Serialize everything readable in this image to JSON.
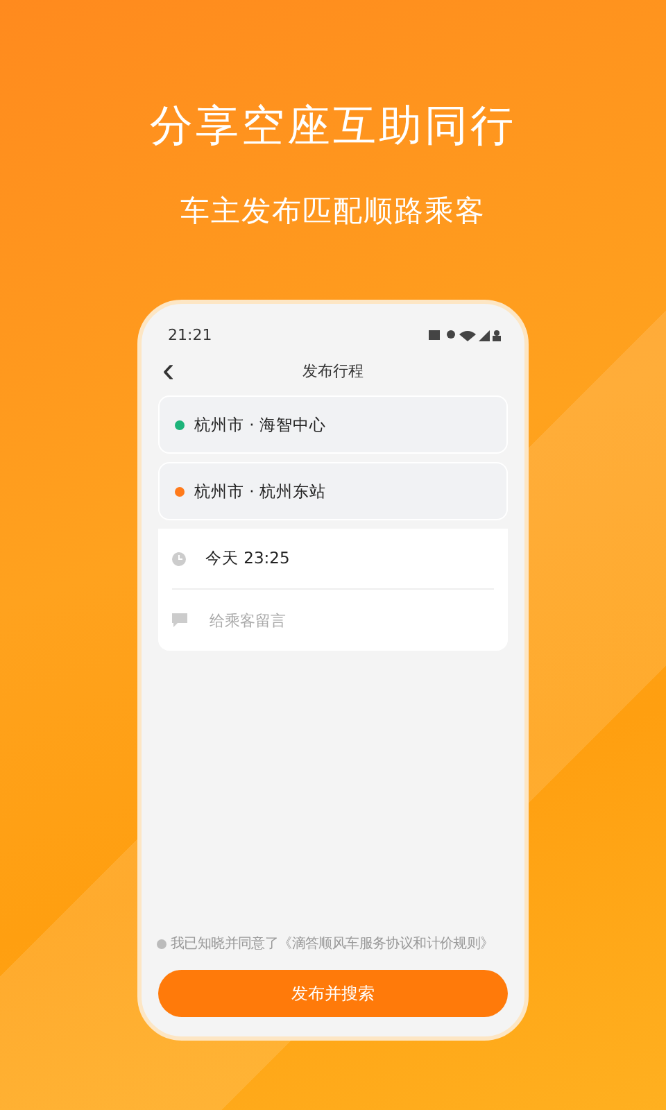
{
  "headline": "分享空座互助同行",
  "subheadline": "车主发布匹配顺路乘客",
  "phone": {
    "status_bar": {
      "time": "21:21"
    },
    "nav": {
      "back": "‹",
      "title": "发布行程"
    },
    "locations": [
      {
        "text": "杭州市 · 海智中心",
        "color": "#1db47a"
      },
      {
        "text": "杭州市 · 杭州东站",
        "color": "#ff7a1a"
      }
    ],
    "time": {
      "value": "今天 23:25"
    },
    "message": {
      "placeholder": "给乘客留言"
    },
    "agreement": {
      "text": "我已知晓并同意了《滴答顺风车服务协议和计价规则》",
      "checked": false
    },
    "submit": "发布并搜索"
  }
}
